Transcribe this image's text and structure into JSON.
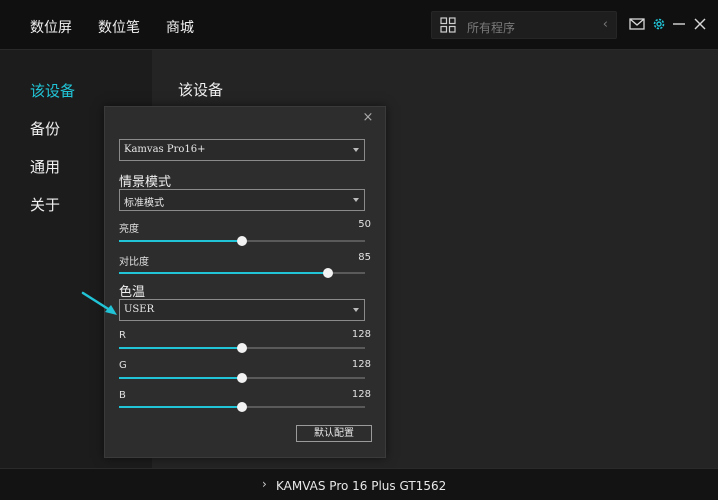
{
  "topbar": {
    "nav": [
      "数位屏",
      "数位笔",
      "商城"
    ],
    "search_placeholder": "所有程序",
    "icons": [
      "apps-grid-icon",
      "chevron-left-icon",
      "mail-icon",
      "gear-icon",
      "minimize-icon",
      "close-icon"
    ],
    "accent": "#21c4d6"
  },
  "sidebar": {
    "items": [
      "该设备",
      "备份",
      "通用",
      "关于"
    ],
    "active_index": 0
  },
  "main": {
    "title": "该设备"
  },
  "dialog": {
    "device_select": "Kamvas Pro16+",
    "profile_label": "情景模式",
    "profile_select": "标准模式",
    "brightness": {
      "label": "亮度",
      "value": "50",
      "fraction": 0.5
    },
    "contrast": {
      "label": "对比度",
      "value": "85",
      "fraction": 0.85
    },
    "color_temp_label": "色温",
    "color_temp_select": "USER",
    "r": {
      "label": "R",
      "value": "128",
      "fraction": 0.5
    },
    "g": {
      "label": "G",
      "value": "128",
      "fraction": 0.5
    },
    "b": {
      "label": "B",
      "value": "128",
      "fraction": 0.5
    },
    "reset_button": "默认配置"
  },
  "bottombar": {
    "device_name": "KAMVAS Pro 16 Plus GT1562"
  }
}
